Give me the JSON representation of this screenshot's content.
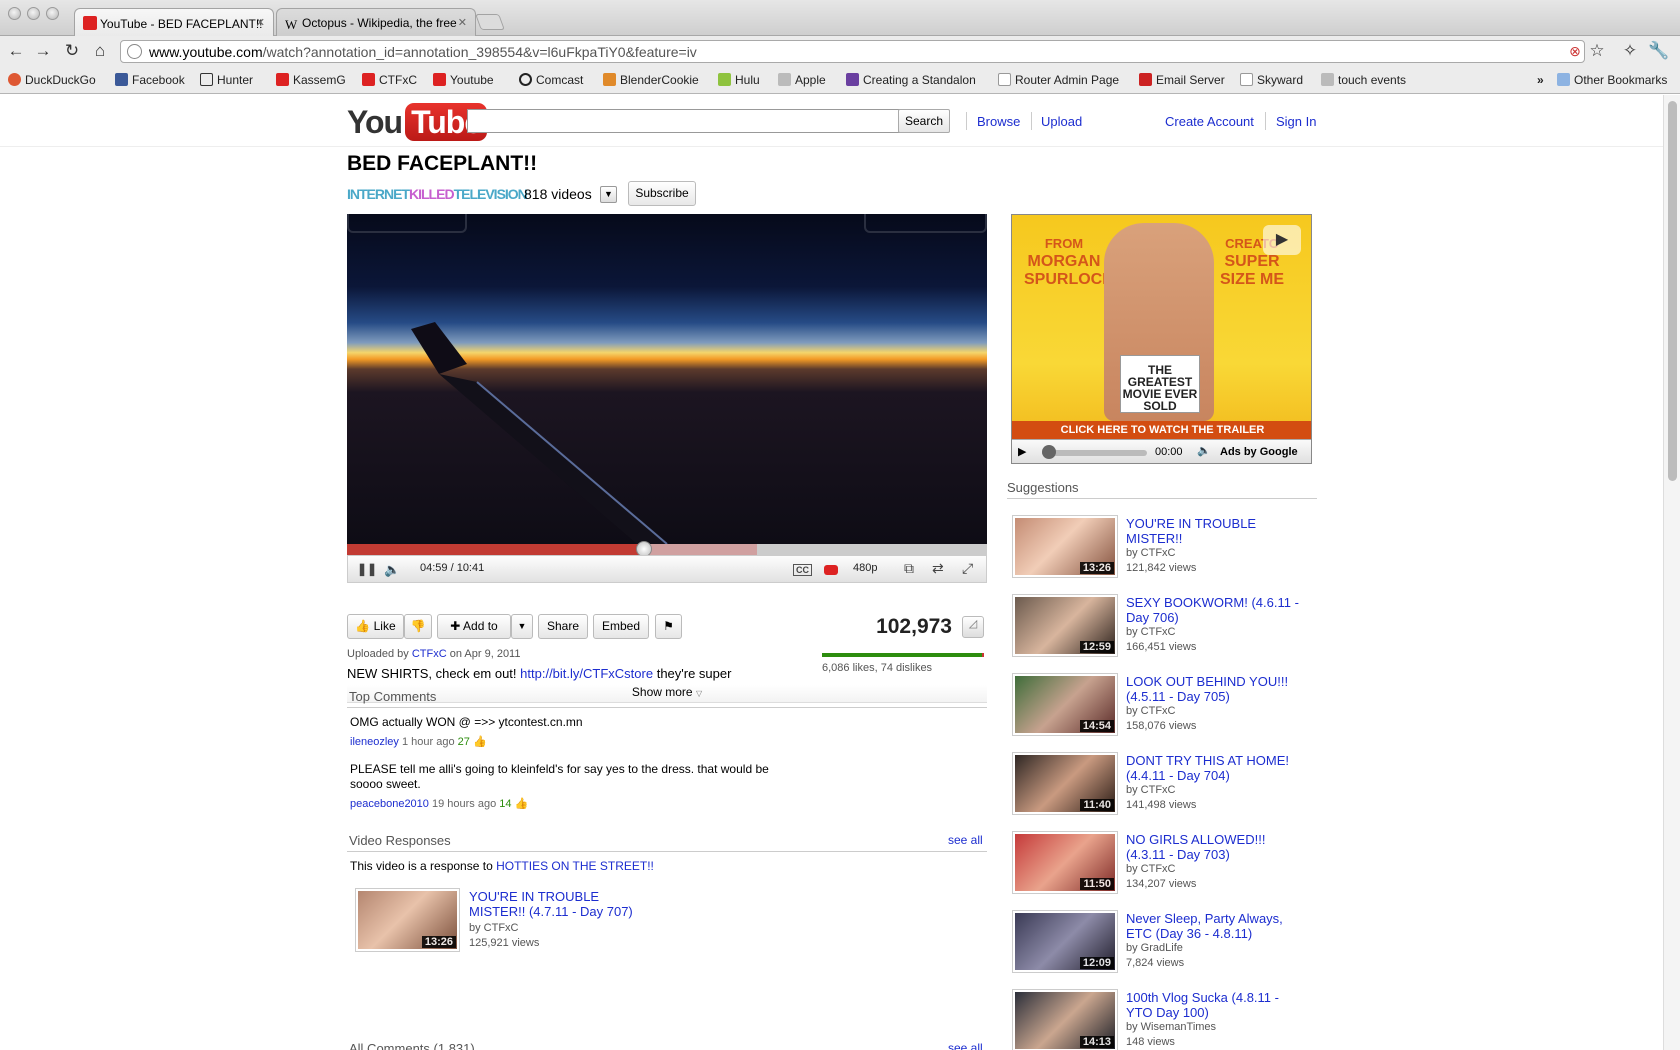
{
  "browser": {
    "tabs": [
      {
        "title": "YouTube - BED FACEPLANT!!",
        "favicon": "youtube-favicon"
      },
      {
        "title": "Octopus - Wikipedia, the free",
        "favicon": "wikipedia-favicon"
      }
    ],
    "url_host": "www.youtube.com",
    "url_path": "/watch?annotation_id=annotation_398554&v=l6uFkpaTiY0&feature=iv",
    "bookmarks": [
      "DuckDuckGo",
      "Facebook",
      "Hunter",
      "KassemG",
      "CTFxC",
      "Youtube",
      "Comcast",
      "BlenderCookie",
      "Hulu",
      "Apple",
      "Creating a Standalon",
      "Router Admin Page",
      "Email Server",
      "Skyward",
      "touch events"
    ],
    "bookmark_overflow": "»",
    "other_bookmarks": "Other Bookmarks"
  },
  "masthead": {
    "logo_you": "You",
    "logo_tube": "Tube",
    "search_button": "Search",
    "browse": "Browse",
    "upload": "Upload",
    "create_account": "Create Account",
    "sign_in": "Sign In"
  },
  "video": {
    "title": "BED FACEPLANT!!",
    "channel_logo": [
      "INTERNET",
      "KILLED",
      "TELEVISION"
    ],
    "channel_logo_colors": [
      "#4aa8c8",
      "#c75fcf",
      "#4aa8c8"
    ],
    "video_count": "818 videos",
    "subscribe": "Subscribe",
    "time": "04:59 / 10:41",
    "progress_fraction": 0.464,
    "buffered_fraction": 0.64,
    "quality": "480p",
    "cc": "CC",
    "views": "102,973",
    "like_fraction": 0.988,
    "likes_text": "6,086 likes, 74 dislikes",
    "uploaded_prefix": "Uploaded by",
    "uploader": "CTFxC",
    "uploaded_date": "on Apr 9, 2011",
    "desc_text": "NEW SHIRTS, check em out!",
    "desc_link": "http://bit.ly/CTFxCstore",
    "desc_suffix": "they're super",
    "show_more": "Show more"
  },
  "actions": {
    "like": "Like",
    "add_to": "Add to",
    "share": "Share",
    "embed": "Embed"
  },
  "comments": {
    "heading": "Top Comments",
    "items": [
      {
        "text": "OMG actually WON @ =>> ytcontest.cn.mn",
        "user": "ileneozley",
        "time": "1 hour ago",
        "votes": "27"
      },
      {
        "text": "PLEASE tell me alli's going to kleinfeld's for say yes to the dress. that would be soooo sweet.",
        "user": "peacebone2010",
        "time": "19 hours ago",
        "votes": "14"
      }
    ]
  },
  "responses": {
    "heading": "Video Responses",
    "see_all": "see all",
    "response_prefix": "This video is a response to",
    "response_link": "HOTTIES ON THE STREET!!",
    "item": {
      "title": "YOU'RE IN TROUBLE MISTER!! (4.7.11 - Day 707)",
      "by": "by CTFxC",
      "views": "125,921 views",
      "duration": "13:26"
    },
    "all_comments": "All Comments (1,831)",
    "all_see_all": "see all"
  },
  "ad": {
    "from": "FROM",
    "director": "MORGAN SPURLOCK",
    "creator": "CREATO",
    "film": "SUPER SIZE ME",
    "sign": "THE GREATEST MOVIE EVER SOLD",
    "cta": "CLICK HERE TO WATCH THE TRAILER",
    "time": "00:00",
    "ads_by": "Ads by Google"
  },
  "suggestions": {
    "heading": "Suggestions",
    "items": [
      {
        "title": "YOU'RE IN TROUBLE MISTER!!",
        "by": "by CTFxC",
        "views": "121,842 views",
        "duration": "13:26"
      },
      {
        "title": "SEXY BOOKWORM! (4.6.11 - Day 706)",
        "by": "by CTFxC",
        "views": "166,451 views",
        "duration": "12:59"
      },
      {
        "title": "LOOK OUT BEHIND YOU!!! (4.5.11 - Day 705)",
        "by": "by CTFxC",
        "views": "158,076 views",
        "duration": "14:54"
      },
      {
        "title": "DONT TRY THIS AT HOME! (4.4.11 - Day 704)",
        "by": "by CTFxC",
        "views": "141,498 views",
        "duration": "11:40"
      },
      {
        "title": "NO GIRLS ALLOWED!!! (4.3.11 - Day 703)",
        "by": "by CTFxC",
        "views": "134,207 views",
        "duration": "11:50"
      },
      {
        "title": "Never Sleep, Party Always, ETC (Day 36 - 4.8.11)",
        "by": "by GradLife",
        "views": "7,824 views",
        "duration": "12:09"
      },
      {
        "title": "100th Vlog Sucka (4.8.11 - YTO Day 100)",
        "by": "by WisemanTimes",
        "views": "148 views",
        "duration": "14:13"
      }
    ]
  }
}
